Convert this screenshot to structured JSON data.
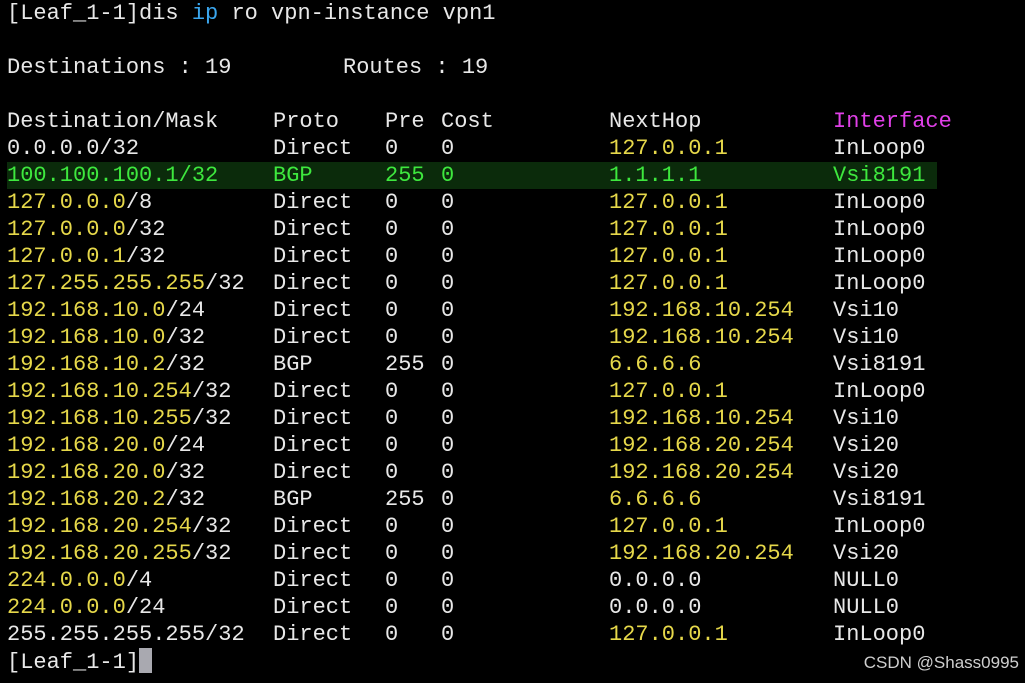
{
  "colors": {
    "background": "#000000",
    "default_text": "#e8e8e8",
    "yellow": "#e6d84a",
    "green": "#3ee83e",
    "highlight_bg": "#0b2b0b",
    "keyword_blue": "#3aa6ee",
    "interface_magenta": "#e040e8"
  },
  "command": {
    "prompt": "[Leaf_1-1]",
    "pre": "dis ",
    "keyword": "ip",
    "post": " ro vpn-instance vpn1"
  },
  "summary": {
    "destinations_label": "Destinations : 19",
    "routes_label": "Routes : 19"
  },
  "table": {
    "headers": {
      "dest": "Destination/Mask",
      "proto": "Proto",
      "pre": "Pre",
      "cost": "Cost",
      "nexthop": "NextHop",
      "interface": "Interface"
    },
    "rows": [
      {
        "ip": "0.0.0.0",
        "mask": "/32",
        "proto": "Direct",
        "pre": "0",
        "cost": "0",
        "nexthop": "127.0.0.1",
        "iface": "InLoop0"
      },
      {
        "ip": "100.100.100.1",
        "mask": "/32",
        "proto": "BGP",
        "pre": "255",
        "cost": "0",
        "nexthop": "1.1.1.1",
        "iface": "Vsi8191"
      },
      {
        "ip": "127.0.0.0",
        "mask": "/8",
        "proto": "Direct",
        "pre": "0",
        "cost": "0",
        "nexthop": "127.0.0.1",
        "iface": "InLoop0"
      },
      {
        "ip": "127.0.0.0",
        "mask": "/32",
        "proto": "Direct",
        "pre": "0",
        "cost": "0",
        "nexthop": "127.0.0.1",
        "iface": "InLoop0"
      },
      {
        "ip": "127.0.0.1",
        "mask": "/32",
        "proto": "Direct",
        "pre": "0",
        "cost": "0",
        "nexthop": "127.0.0.1",
        "iface": "InLoop0"
      },
      {
        "ip": "127.255.255.255",
        "mask": "/32",
        "proto": "Direct",
        "pre": "0",
        "cost": "0",
        "nexthop": "127.0.0.1",
        "iface": "InLoop0"
      },
      {
        "ip": "192.168.10.0",
        "mask": "/24",
        "proto": "Direct",
        "pre": "0",
        "cost": "0",
        "nexthop": "192.168.10.254",
        "iface": "Vsi10"
      },
      {
        "ip": "192.168.10.0",
        "mask": "/32",
        "proto": "Direct",
        "pre": "0",
        "cost": "0",
        "nexthop": "192.168.10.254",
        "iface": "Vsi10"
      },
      {
        "ip": "192.168.10.2",
        "mask": "/32",
        "proto": "BGP",
        "pre": "255",
        "cost": "0",
        "nexthop": "6.6.6.6",
        "iface": "Vsi8191"
      },
      {
        "ip": "192.168.10.254",
        "mask": "/32",
        "proto": "Direct",
        "pre": "0",
        "cost": "0",
        "nexthop": "127.0.0.1",
        "iface": "InLoop0"
      },
      {
        "ip": "192.168.10.255",
        "mask": "/32",
        "proto": "Direct",
        "pre": "0",
        "cost": "0",
        "nexthop": "192.168.10.254",
        "iface": "Vsi10"
      },
      {
        "ip": "192.168.20.0",
        "mask": "/24",
        "proto": "Direct",
        "pre": "0",
        "cost": "0",
        "nexthop": "192.168.20.254",
        "iface": "Vsi20"
      },
      {
        "ip": "192.168.20.0",
        "mask": "/32",
        "proto": "Direct",
        "pre": "0",
        "cost": "0",
        "nexthop": "192.168.20.254",
        "iface": "Vsi20"
      },
      {
        "ip": "192.168.20.2",
        "mask": "/32",
        "proto": "BGP",
        "pre": "255",
        "cost": "0",
        "nexthop": "6.6.6.6",
        "iface": "Vsi8191"
      },
      {
        "ip": "192.168.20.254",
        "mask": "/32",
        "proto": "Direct",
        "pre": "0",
        "cost": "0",
        "nexthop": "127.0.0.1",
        "iface": "InLoop0"
      },
      {
        "ip": "192.168.20.255",
        "mask": "/32",
        "proto": "Direct",
        "pre": "0",
        "cost": "0",
        "nexthop": "192.168.20.254",
        "iface": "Vsi20"
      },
      {
        "ip": "224.0.0.0",
        "mask": "/4",
        "proto": "Direct",
        "pre": "0",
        "cost": "0",
        "nexthop": "0.0.0.0",
        "iface": "NULL0"
      },
      {
        "ip": "224.0.0.0",
        "mask": "/24",
        "proto": "Direct",
        "pre": "0",
        "cost": "0",
        "nexthop": "0.0.0.0",
        "iface": "NULL0"
      },
      {
        "ip": "255.255.255.255",
        "mask": "/32",
        "proto": "Direct",
        "pre": "0",
        "cost": "0",
        "nexthop": "127.0.0.1",
        "iface": "InLoop0"
      }
    ]
  },
  "footer": {
    "prompt": "[Leaf_1-1]"
  },
  "watermark": "CSDN @Shass0995"
}
